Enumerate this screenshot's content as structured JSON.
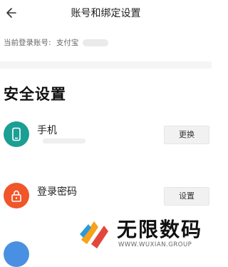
{
  "header": {
    "title": "账号和绑定设置"
  },
  "account": {
    "label": "当前登录账号:",
    "value": "支付宝"
  },
  "section": {
    "title": "安全设置"
  },
  "rows": [
    {
      "label": "手机",
      "button": "更换",
      "icon": "phone-icon",
      "color": "#1b9f95"
    },
    {
      "label": "登录密码",
      "button": "设置",
      "icon": "lock-icon",
      "color": "#f0562a"
    }
  ],
  "watermark": {
    "name": "无限数码",
    "url": "WWW.WUXIAN.GROUP"
  }
}
